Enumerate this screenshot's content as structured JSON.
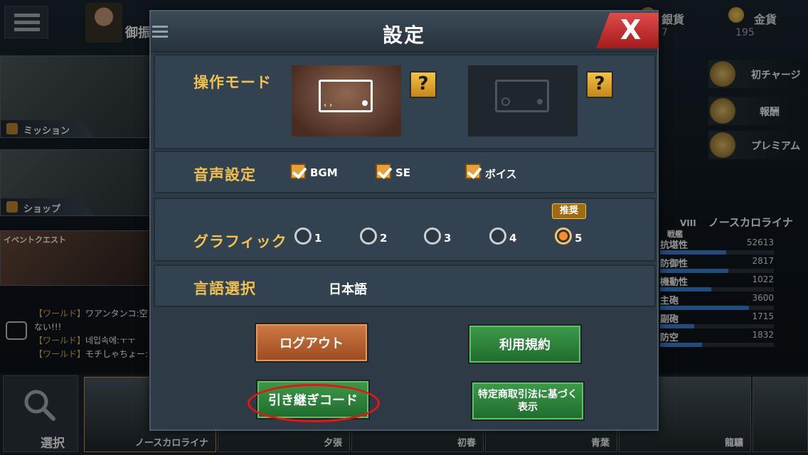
{
  "background": {
    "commander_label": "御振",
    "silver_label": "銀貨",
    "silver_value": "7",
    "gold_label": "金貨",
    "gold_value": "195",
    "side_menu": [
      {
        "label": "ミッション"
      },
      {
        "label": "ショップ"
      },
      {
        "label": "イベントクエスト"
      }
    ],
    "right_menu": [
      {
        "label": "初チャージ"
      },
      {
        "label": "報酬"
      },
      {
        "label": "プレミアム"
      }
    ],
    "chat": [
      {
        "channel": "【ワールド】",
        "text": "ワアンタンコ:空"
      },
      {
        "channel": "",
        "text": "ない!!!"
      },
      {
        "channel": "【ワールド】",
        "text": "네입속에:ㅜㅜ"
      },
      {
        "channel": "【ワールド】",
        "text": "モチしゃちょー:"
      }
    ],
    "ship_info": {
      "rank": "VIII",
      "name": "ノースカロライナ",
      "type": "戦艦",
      "stats": [
        {
          "label": "抗堪性",
          "value": "52613",
          "fill": 0.58
        },
        {
          "label": "防御性",
          "value": "2817",
          "fill": 0.6
        },
        {
          "label": "機動性",
          "value": "1022",
          "fill": 0.45
        },
        {
          "label": "主砲",
          "value": "3600",
          "fill": 0.78
        },
        {
          "label": "副砲",
          "value": "1715",
          "fill": 0.3
        },
        {
          "label": "防空",
          "value": "1832",
          "fill": 0.37
        }
      ]
    },
    "select_label": "選択",
    "ship_cards": [
      {
        "name": "ノースカロライナ"
      },
      {
        "name": "夕張"
      },
      {
        "name": "初春"
      },
      {
        "name": "青葉"
      },
      {
        "name": "龍驤"
      }
    ]
  },
  "dialog": {
    "title": "設定",
    "close_label": "X",
    "control_mode": {
      "label": "操作モード",
      "help_label": "?"
    },
    "sound": {
      "label": "音声設定",
      "options": [
        {
          "label": "BGM",
          "checked": true
        },
        {
          "label": "SE",
          "checked": true
        },
        {
          "label": "ボイス",
          "checked": true
        }
      ]
    },
    "graphics": {
      "label": "グラフィック",
      "options": [
        "1",
        "2",
        "3",
        "4",
        "5"
      ],
      "selected": "5",
      "recommended_label": "推奨"
    },
    "language": {
      "label": "言語選択",
      "value": "日本語"
    },
    "buttons": {
      "logout": "ログアウト",
      "terms": "利用規約",
      "transfer_code": "引き継ぎコード",
      "commerce_law": "特定商取引法に基づく表示"
    }
  },
  "colors": {
    "accent_gold": "#f0c050",
    "button_green": "#2e8a3c",
    "button_orange": "#c06a38",
    "close_red": "#d03030",
    "highlight_circle": "#e11111"
  }
}
